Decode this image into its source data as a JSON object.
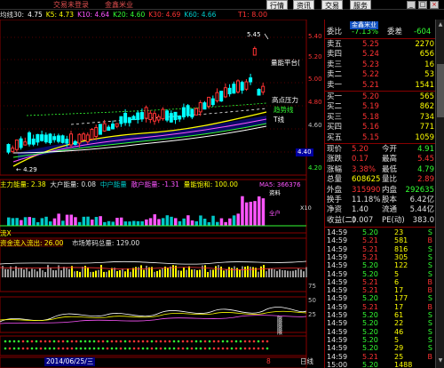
{
  "topbar": {
    "links": [
      "交易未登录",
      "金鑫米业"
    ],
    "menus": [
      "行情",
      "资讯",
      "交易",
      "服务"
    ],
    "win_buttons": [
      "_",
      "□",
      "×"
    ]
  },
  "ma_line": {
    "label": "均线30:",
    "items": [
      {
        "text": "4.75",
        "color": "#ffffff"
      },
      {
        "text": "K5: 4.73",
        "color": "#ffff00"
      },
      {
        "text": "K10: 4.64",
        "color": "#ff55ff"
      },
      {
        "text": "K20: 4.60",
        "color": "#33ff33"
      },
      {
        "text": "K30: 4.69",
        "color": "#ff3333"
      },
      {
        "text": "K60: 4.66",
        "color": "#00c8c8"
      }
    ],
    "t1": "T1: 8.00"
  },
  "main_chart": {
    "y_labels": [
      "5.40",
      "5.20",
      "5.00",
      "4.80",
      "4.60",
      "4.40",
      "4.20"
    ],
    "current_price_label": "4.40",
    "high_marker": "5.45",
    "low_marker": "4.29",
    "annotations": [
      "量能平台(",
      "高点压力",
      "趋势线",
      "T线"
    ],
    "title_hint": "金鑫米业"
  },
  "vol_panel": {
    "labels": [
      {
        "text": "主力能量: 2.38",
        "color": "#ffff00"
      },
      {
        "text": "大户能量: 0.08",
        "color": "#e0e0e0"
      },
      {
        "text": "中户能量",
        "color": "#00c8c8"
      },
      {
        "text": "散户能量: -1.31",
        "color": "#ff55ff"
      },
      {
        "text": "量能饱和: 100.00",
        "color": "#ffff00"
      }
    ],
    "ma5": "MA5: 366376",
    "x10": "X10",
    "tags": [
      "资料",
      "全户"
    ]
  },
  "flow_panel": {
    "labels": [
      {
        "text": "资金流入流出: 26.00",
        "color": "#ffff00"
      },
      {
        "text": "市场筹码总量: 129.00",
        "color": "#e0e0e0"
      }
    ],
    "prefix": "流X"
  },
  "lower_panel": {
    "y_labels": [
      "75",
      "50",
      "25"
    ],
    "side_tags": [
      "限",
      "限",
      "限",
      "限"
    ]
  },
  "bottom": {
    "date": "2014/06/25/三",
    "marks": [
      "8",
      "日线"
    ]
  },
  "quote": {
    "weibi": {
      "label": "委比",
      "value": "-7.13%",
      "diff_label": "委差",
      "diff": "-604"
    },
    "sells": [
      {
        "label": "卖五",
        "price": "5.25",
        "vol": "2270"
      },
      {
        "label": "卖四",
        "price": "5.24",
        "vol": "656"
      },
      {
        "label": "卖三",
        "price": "5.23",
        "vol": "16"
      },
      {
        "label": "卖二",
        "price": "5.22",
        "vol": "53"
      },
      {
        "label": "卖一",
        "price": "5.21",
        "vol": "1541"
      }
    ],
    "buys": [
      {
        "label": "买一",
        "price": "5.20",
        "vol": "565"
      },
      {
        "label": "买二",
        "price": "5.19",
        "vol": "862"
      },
      {
        "label": "买三",
        "price": "5.18",
        "vol": "734"
      },
      {
        "label": "买四",
        "price": "5.16",
        "vol": "771"
      },
      {
        "label": "买五",
        "price": "5.15",
        "vol": "1059"
      }
    ],
    "stats": [
      {
        "l1": "现价",
        "v1": "5.20",
        "c1": "#ff3333",
        "l2": "今开",
        "v2": "4.91",
        "c2": "#33ff33"
      },
      {
        "l1": "涨跌",
        "v1": "0.17",
        "c1": "#ff3333",
        "l2": "最高",
        "v2": "5.45",
        "c2": "#ff3333"
      },
      {
        "l1": "涨幅",
        "v1": "3.38%",
        "c1": "#ff3333",
        "l2": "最低",
        "v2": "4.79",
        "c2": "#33ff33"
      },
      {
        "l1": "总量",
        "v1": "608625",
        "c1": "#ffff00",
        "l2": "量比",
        "v2": "2.89",
        "c2": "#ff3333"
      },
      {
        "l1": "外盘",
        "v1": "315990",
        "c1": "#ff3333",
        "l2": "内盘",
        "v2": "292635",
        "c2": "#33ff33"
      },
      {
        "l1": "换手",
        "v1": "11.18%",
        "c1": "#e0e0e0",
        "l2": "股本",
        "v2": "6.42亿",
        "c2": "#e0e0e0"
      },
      {
        "l1": "净资",
        "v1": "1.40",
        "c1": "#e0e0e0",
        "l2": "流通",
        "v2": "5.44亿",
        "c2": "#e0e0e0"
      },
      {
        "l1": "收益(二)",
        "v1": "0.007",
        "c1": "#e0e0e0",
        "l2": "PE(动)",
        "v2": "383.0",
        "c2": "#e0e0e0"
      }
    ],
    "ticks": [
      {
        "t": "14:59",
        "p": "5.20",
        "v": "23",
        "bs": "S"
      },
      {
        "t": "14:59",
        "p": "5.21",
        "v": "581",
        "bs": "B"
      },
      {
        "t": "14:59",
        "p": "5.21",
        "v": "816",
        "bs": "S"
      },
      {
        "t": "14:59",
        "p": "5.21",
        "v": "305",
        "bs": "S"
      },
      {
        "t": "14:59",
        "p": "5.20",
        "v": "122",
        "bs": "S"
      },
      {
        "t": "14:59",
        "p": "5.20",
        "v": "5",
        "bs": "S"
      },
      {
        "t": "14:59",
        "p": "5.21",
        "v": "6",
        "bs": "B"
      },
      {
        "t": "14:59",
        "p": "5.21",
        "v": "17",
        "bs": "B"
      },
      {
        "t": "14:59",
        "p": "5.20",
        "v": "177",
        "bs": "S"
      },
      {
        "t": "14:59",
        "p": "5.21",
        "v": "17",
        "bs": "B"
      },
      {
        "t": "14:59",
        "p": "5.20",
        "v": "61",
        "bs": "S"
      },
      {
        "t": "14:59",
        "p": "5.20",
        "v": "22",
        "bs": "S"
      },
      {
        "t": "14:59",
        "p": "5.20",
        "v": "46",
        "bs": "S"
      },
      {
        "t": "14:59",
        "p": "5.20",
        "v": "5",
        "bs": "S"
      },
      {
        "t": "14:59",
        "p": "5.20",
        "v": "29",
        "bs": "S"
      },
      {
        "t": "14:59",
        "p": "5.21",
        "v": "25",
        "bs": "B"
      },
      {
        "t": "15:00",
        "p": "5.20",
        "v": "1488",
        "bs": ""
      }
    ]
  }
}
